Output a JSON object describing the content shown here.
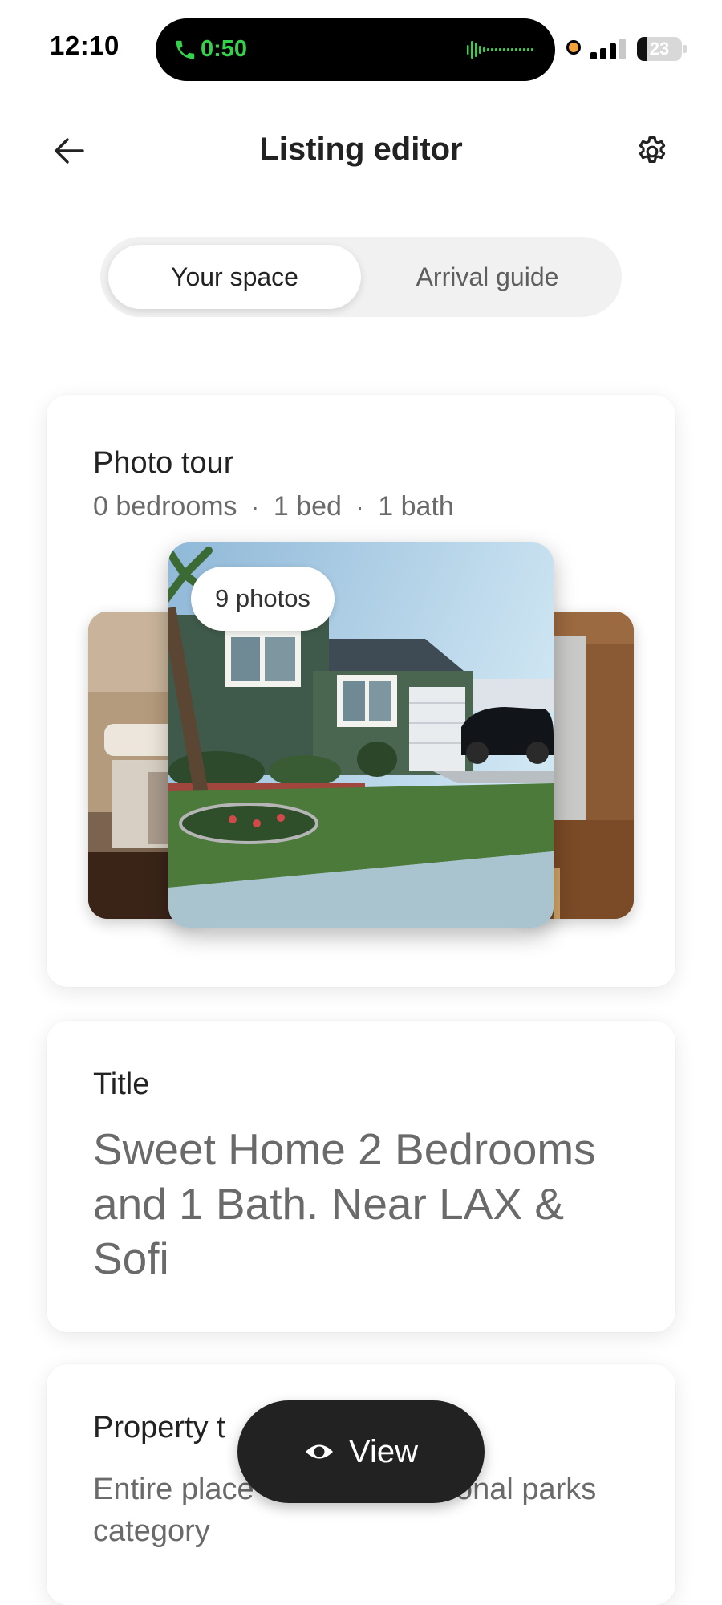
{
  "status_bar": {
    "time": "12:10",
    "call_timer": "0:50",
    "battery_level": "23",
    "battery_fraction": 0.23
  },
  "header": {
    "title": "Listing editor",
    "back_icon": "arrow-left-icon",
    "settings_icon": "gear-icon"
  },
  "tabs": [
    {
      "label": "Your space",
      "active": true
    },
    {
      "label": "Arrival guide",
      "active": false
    }
  ],
  "photo_tour": {
    "heading": "Photo tour",
    "bedrooms": "0 bedrooms",
    "beds": "1 bed",
    "baths": "1 bath",
    "separator": "·",
    "photo_count_label": "9 photos"
  },
  "title_section": {
    "heading": "Title",
    "value": "Sweet Home 2 Bedrooms and 1 Bath. Near LAX & Sofi"
  },
  "property_section": {
    "heading": "Property t",
    "value": "Entire place                       ional parks category"
  },
  "view_button": {
    "label": "View",
    "icon": "eye-icon"
  },
  "colors": {
    "accent_call_green": "#35d14a",
    "text_primary": "#222222",
    "text_secondary": "#6a6a6a",
    "button_dark": "#222222"
  }
}
